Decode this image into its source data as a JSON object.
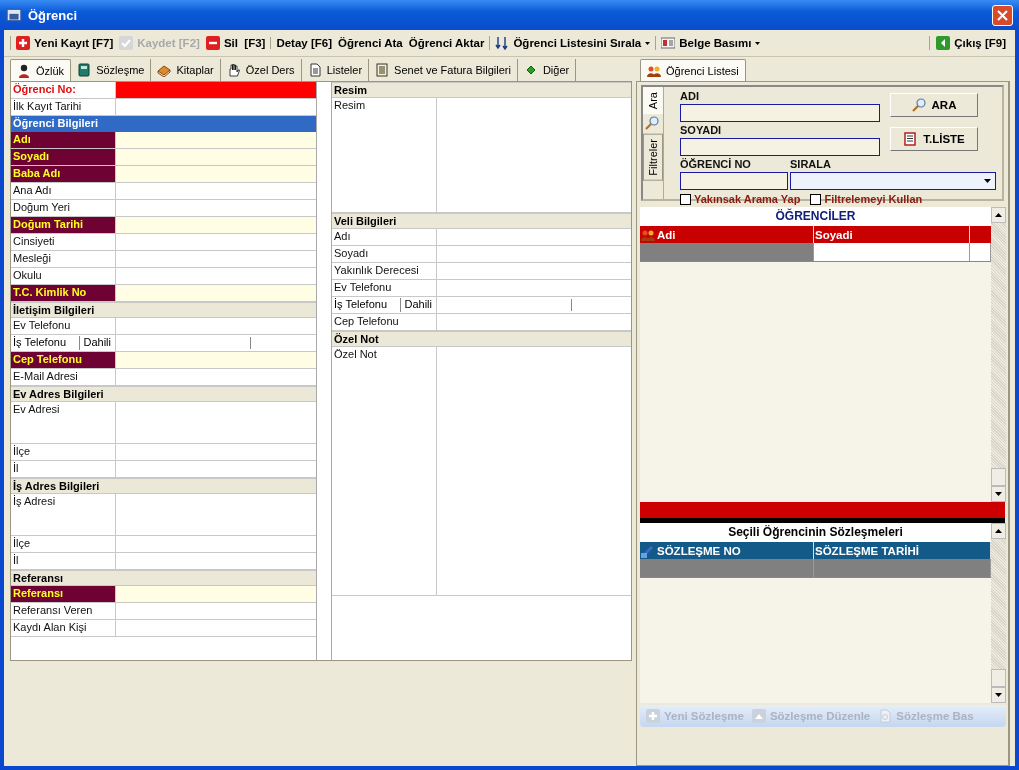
{
  "window": {
    "title": "Öğrenci"
  },
  "toolbar": {
    "groups": [
      [
        {
          "label": "Yeni Kayıt [F7]",
          "kind": "add",
          "disabled": false,
          "dropdown": false
        },
        {
          "label": "Kaydet [F2]",
          "kind": "check",
          "disabled": true,
          "dropdown": false
        },
        {
          "label": "Sil  [F3]",
          "kind": "remove",
          "disabled": false,
          "dropdown": false
        }
      ],
      [
        {
          "label": "Detay [F6]",
          "kind": "text",
          "disabled": false,
          "dropdown": false
        },
        {
          "label": "Öğrenci Ata",
          "kind": "text",
          "disabled": false,
          "dropdown": false
        },
        {
          "label": "Öğrenci Aktar",
          "kind": "text",
          "disabled": false,
          "dropdown": false
        }
      ],
      [
        {
          "label": "Öğrenci Listesini Sırala",
          "kind": "sort",
          "disabled": false,
          "dropdown": true
        }
      ],
      [
        {
          "label": "Belge Basımı",
          "kind": "card",
          "disabled": false,
          "dropdown": true
        }
      ]
    ],
    "end": [
      {
        "label": "Çıkış [F9]",
        "kind": "exit",
        "disabled": false,
        "dropdown": false
      }
    ]
  },
  "tabs": [
    {
      "label": "Özlük",
      "kind": "person",
      "selected": true
    },
    {
      "label": "Sözleşme",
      "kind": "book",
      "selected": false
    },
    {
      "label": "Kitaplar",
      "kind": "books",
      "selected": false
    },
    {
      "label": "Özel Ders",
      "kind": "hand",
      "selected": false
    },
    {
      "label": "Listeler",
      "kind": "page",
      "selected": false
    },
    {
      "label": "Senet ve Fatura Bilgileri",
      "kind": "ledger",
      "selected": false
    },
    {
      "label": "Diğer",
      "kind": "diamond",
      "selected": false
    }
  ],
  "form_left": [
    {
      "kind": "key",
      "label": "Öğrenci No:"
    },
    {
      "kind": "field",
      "label": "İlk Kayıt Tarihi"
    },
    {
      "kind": "active-section",
      "label": "Öğrenci Bilgileri"
    },
    {
      "kind": "required",
      "label": "Adı"
    },
    {
      "kind": "required",
      "label": "Soyadı"
    },
    {
      "kind": "required",
      "label": "Baba Adı"
    },
    {
      "kind": "field",
      "label": "Ana Adı"
    },
    {
      "kind": "field",
      "label": "Doğum Yeri"
    },
    {
      "kind": "required",
      "label": "Doğum Tarihi"
    },
    {
      "kind": "field",
      "label": "Cinsiyeti"
    },
    {
      "kind": "field",
      "label": "Mesleği"
    },
    {
      "kind": "field",
      "label": "Okulu"
    },
    {
      "kind": "required",
      "label": "T.C. Kimlik No"
    },
    {
      "kind": "section",
      "label": "İletişim Bilgileri"
    },
    {
      "kind": "field",
      "label": "Ev Telefonu"
    },
    {
      "kind": "phone",
      "label": "İş Telefonu",
      "extension_label": "Dahili"
    },
    {
      "kind": "required",
      "label": "Cep Telefonu"
    },
    {
      "kind": "field",
      "label": "E-Mail Adresi"
    },
    {
      "kind": "section",
      "label": "Ev Adres Bilgileri"
    },
    {
      "kind": "multiline",
      "label": "Ev Adresi"
    },
    {
      "kind": "field",
      "label": "İlçe"
    },
    {
      "kind": "field",
      "label": "İl"
    },
    {
      "kind": "section",
      "label": "İş Adres Bilgileri"
    },
    {
      "kind": "multiline",
      "label": "İş Adresi"
    },
    {
      "kind": "field",
      "label": "İlçe"
    },
    {
      "kind": "field",
      "label": "İl"
    },
    {
      "kind": "section",
      "label": "Referansı"
    },
    {
      "kind": "required",
      "label": "Referansı"
    },
    {
      "kind": "field",
      "label": "Referansı Veren"
    },
    {
      "kind": "field",
      "label": "Kaydı Alan Kişi"
    }
  ],
  "form_right": [
    {
      "kind": "section",
      "label": "Resim"
    },
    {
      "kind": "image",
      "label": "Resim"
    },
    {
      "kind": "section",
      "label": "Veli Bilgileri"
    },
    {
      "kind": "field",
      "label": "Adı"
    },
    {
      "kind": "field",
      "label": "Soyadı"
    },
    {
      "kind": "field",
      "label": "Yakınlık Derecesi"
    },
    {
      "kind": "field",
      "label": "Ev Telefonu"
    },
    {
      "kind": "phone",
      "label": "İş Telefonu",
      "extension_label": "Dahili"
    },
    {
      "kind": "field",
      "label": "Cep Telefonu"
    },
    {
      "kind": "section",
      "label": "Özel Not"
    },
    {
      "kind": "note",
      "label": "Özel Not"
    }
  ],
  "side_tabs": [
    {
      "label": "Öğrenci Listesi",
      "selected": true
    }
  ],
  "search": {
    "side_tabs": [
      {
        "label": "Ara",
        "selected": true
      },
      {
        "label": "Filtreler",
        "selected": false
      }
    ],
    "fields": [
      {
        "label": "ADI",
        "kind": "text"
      },
      {
        "label": "SOYADI",
        "kind": "text"
      },
      {
        "label": "ÖĞRENCİ NO",
        "kind": "text"
      },
      {
        "label": "SIRALA",
        "kind": "dropdown"
      }
    ],
    "buttons": [
      {
        "label": "ARA",
        "kind": "search"
      },
      {
        "label": "T.LİSTE",
        "kind": "list"
      }
    ],
    "checkboxes": [
      {
        "label": "Yakınsak Arama Yap",
        "checked": false
      },
      {
        "label": "Filtrelemeyi Kullan",
        "checked": false
      }
    ]
  },
  "students_grid": {
    "title": "ÖĞRENCİLER",
    "columns": [
      "Adi",
      "Soyadi"
    ],
    "rows": [
      {
        "cells": [
          {
            "selected": true
          },
          {
            "selected": false
          }
        ]
      }
    ]
  },
  "contracts_grid": {
    "title": "Seçili Öğrencinin Sözleşmeleri",
    "columns": [
      "SÖZLEŞME NO",
      "SÖZLEŞME TARİHİ"
    ],
    "rows": [
      {
        "cells": [
          {
            "selected": true
          },
          {
            "selected": true
          }
        ]
      }
    ]
  },
  "contract_actions": [
    {
      "label": "Yeni Sözleşme",
      "kind": "add",
      "disabled": true
    },
    {
      "label": "Sözleşme Düzenle",
      "kind": "edit",
      "disabled": true
    },
    {
      "label": "Sözleşme Bas",
      "kind": "print",
      "disabled": true
    }
  ]
}
